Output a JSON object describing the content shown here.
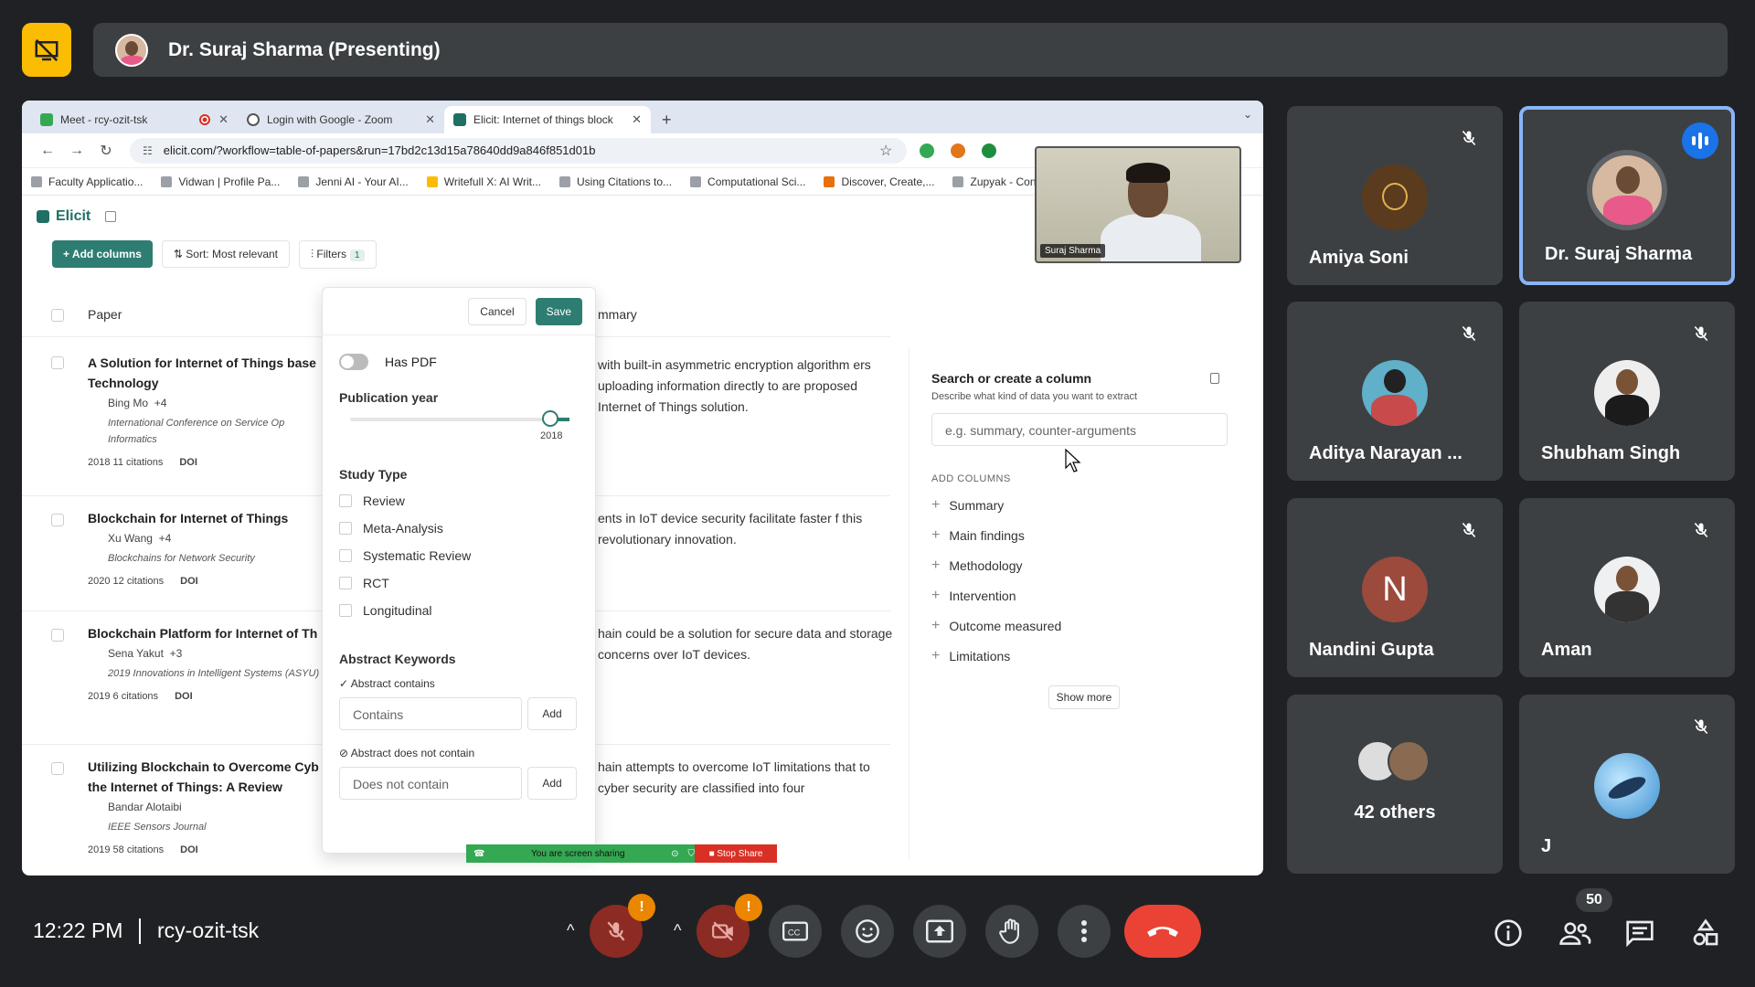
{
  "meeting": {
    "presenter_label": "Dr. Suraj Sharma (Presenting)",
    "time": "12:22 PM",
    "code": "rcy-ozit-tsk",
    "participant_count": "50"
  },
  "browser": {
    "tabs": [
      {
        "label": "Meet - rcy-ozit-tsk"
      },
      {
        "label": "Login with Google - Zoom"
      },
      {
        "label": "Elicit: Internet of things block"
      }
    ],
    "url": "elicit.com/?workflow=table-of-papers&run=17bd2c13d15a78640dd9a846f851d01b",
    "bookmarks": [
      "Faculty Applicatio...",
      "Vidwan | Profile Pa...",
      "Jenni AI - Your AI...",
      "Writefull X: AI Writ...",
      "Using Citations to...",
      "Computational Sci...",
      "Discover, Create,...",
      "Zupyak - Conten"
    ]
  },
  "elicit": {
    "logo": "Elicit",
    "add_columns": "+ Add columns",
    "sort": "Sort: Most relevant",
    "filters": "Filters",
    "filters_count": "1",
    "col_paper": "Paper",
    "col_summary": "mmary",
    "papers": [
      {
        "title": "A Solution for Internet of Things base Technology",
        "author": "Bing Mo",
        "more": "+4",
        "venue": "International Conference on Service Op Informatics",
        "year_cit": "2018 11 citations",
        "doi": "DOI",
        "summary": "with built-in asymmetric encryption algorithm ers uploading information directly to are proposed Internet of Things solution."
      },
      {
        "title": "Blockchain for Internet of Things",
        "author": "Xu Wang",
        "more": "+4",
        "venue": "Blockchains for Network Security",
        "year_cit": "2020 12 citations",
        "doi": "DOI",
        "summary": "ents in IoT device security facilitate faster f this revolutionary innovation."
      },
      {
        "title": "Blockchain Platform for Internet of Th",
        "author": "Sena Yakut",
        "more": "+3",
        "venue": "2019 Innovations in Intelligent Systems (ASYU)",
        "year_cit": "2019 6 citations",
        "doi": "DOI",
        "summary": "hain could be a solution for secure data and storage concerns over IoT devices."
      },
      {
        "title": "Utilizing Blockchain to Overcome Cyb the Internet of Things: A Review",
        "author": "Bandar Alotaibi",
        "more": "",
        "venue": "IEEE Sensors Journal",
        "year_cit": "2019 58 citations",
        "doi": "DOI",
        "summary": "hain attempts to overcome IoT limitations that to cyber security are classified into four"
      }
    ],
    "filter_popup": {
      "cancel": "Cancel",
      "save": "Save",
      "has_pdf": "Has PDF",
      "pub_year": "Publication year",
      "year_value": "2018",
      "study_type": "Study Type",
      "study_options": [
        "Review",
        "Meta-Analysis",
        "Systematic Review",
        "RCT",
        "Longitudinal"
      ],
      "abstract_keywords": "Abstract Keywords",
      "abstract_contains": "Abstract contains",
      "contains_placeholder": "Contains",
      "add": "Add",
      "abstract_not_contain": "Abstract does not contain",
      "not_contain_placeholder": "Does not contain"
    },
    "right_panel": {
      "title": "Search or create a column",
      "subtitle": "Describe what kind of data you want to extract",
      "placeholder": "e.g. summary, counter-arguments",
      "add_columns_label": "ADD COLUMNS",
      "items": [
        "Summary",
        "Main findings",
        "Methodology",
        "Intervention",
        "Outcome measured",
        "Limitations"
      ],
      "show_more": "Show more"
    },
    "camera_label": "Suraj Sharma"
  },
  "share_bar": {
    "status": "You are screen sharing",
    "stop": "Stop Share"
  },
  "participants": [
    {
      "name": "Amiya Soni"
    },
    {
      "name": "Dr. Suraj Sharma"
    },
    {
      "name": "Aditya Narayan ..."
    },
    {
      "name": "Shubham Singh"
    },
    {
      "name": "Nandini Gupta",
      "initial": "N"
    },
    {
      "name": "Aman"
    },
    {
      "name": "42 others"
    },
    {
      "name": "J"
    }
  ],
  "colors": {
    "accent": "#1a73e8",
    "end_call": "#ea4335",
    "elicit_green": "#2e7d72",
    "presenter_yellow": "#fbbc04"
  }
}
